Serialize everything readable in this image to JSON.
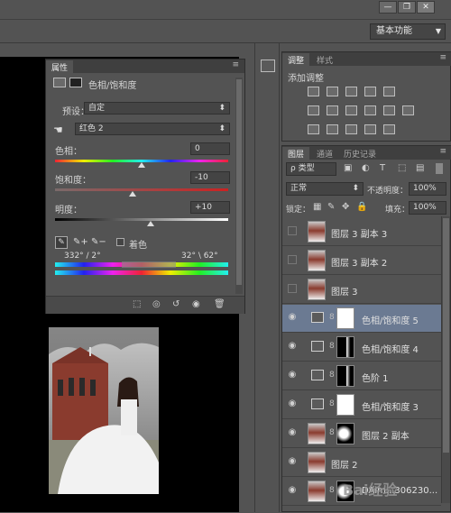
{
  "workspace": {
    "label": "基本功能"
  },
  "properties": {
    "tab_label": "属性",
    "title": "色相/饱和度",
    "preset_label": "预设：",
    "preset_value": "自定",
    "channel_value": "红色 2",
    "hue_label": "色相：",
    "hue_value": "0",
    "hue_level": 0.5,
    "saturation_label": "饱和度：",
    "saturation_value": "-10",
    "saturation_level": 0.45,
    "lightness_label": "明度：",
    "lightness_value": "+10",
    "lightness_level": 0.55,
    "colorize_label": "着色",
    "range_left": "332° / 2°",
    "range_right": "32° \\ 62°"
  },
  "adjustments": {
    "tab1": "调整",
    "tab2": "样式",
    "title": "添加调整"
  },
  "layers": {
    "tab1": "图层",
    "tab2": "通道",
    "tab3": "历史记录",
    "filter_kind": "类型",
    "blend_mode": "正常",
    "opacity_label": "不透明度：",
    "opacity_value": "100%",
    "lock_label": "锁定：",
    "fill_label": "填充：",
    "fill_value": "100%",
    "items": [
      {
        "name": "图层 3 副本 3",
        "kind": "image",
        "visible": false
      },
      {
        "name": "图层 3 副本 2",
        "kind": "image",
        "visible": false
      },
      {
        "name": "图层 3",
        "kind": "image",
        "visible": false
      },
      {
        "name": "色相/饱和度 5",
        "kind": "adjust",
        "visible": true,
        "selected": true
      },
      {
        "name": "色相/饱和度 4",
        "kind": "adjust",
        "visible": true
      },
      {
        "name": "色阶 1",
        "kind": "levels",
        "visible": true
      },
      {
        "name": "色相/饱和度 3",
        "kind": "adjust",
        "visible": true
      },
      {
        "name": "图层 2 副本",
        "kind": "image-mask",
        "visible": true
      },
      {
        "name": "图层 2",
        "kind": "image",
        "visible": true
      },
      {
        "name": "DAim...306230...",
        "kind": "image-mask",
        "visible": true
      }
    ]
  },
  "watermark": "Bai经验"
}
